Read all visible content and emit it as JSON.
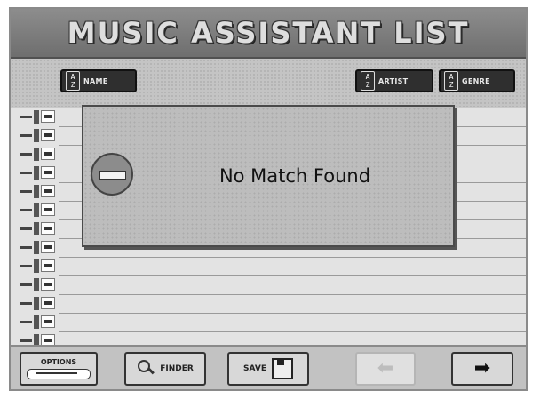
{
  "title": "MUSIC ASSISTANT LIST",
  "sort_buttons": {
    "az_top": "A",
    "az_bottom": "Z",
    "name": "NAME",
    "artist": "ARTIST",
    "genre": "GENRE"
  },
  "popup": {
    "message": "No Match Found",
    "icon": "no-entry-icon"
  },
  "bottom_bar": {
    "options_label": "OPTIONS",
    "finder_label": "FINDER",
    "save_label": "SAVE",
    "prev_icon": "left-arrow-icon",
    "prev_enabled": false,
    "next_icon": "right-arrow-icon",
    "next_glyph": "➡",
    "prev_glyph": "⬅"
  }
}
